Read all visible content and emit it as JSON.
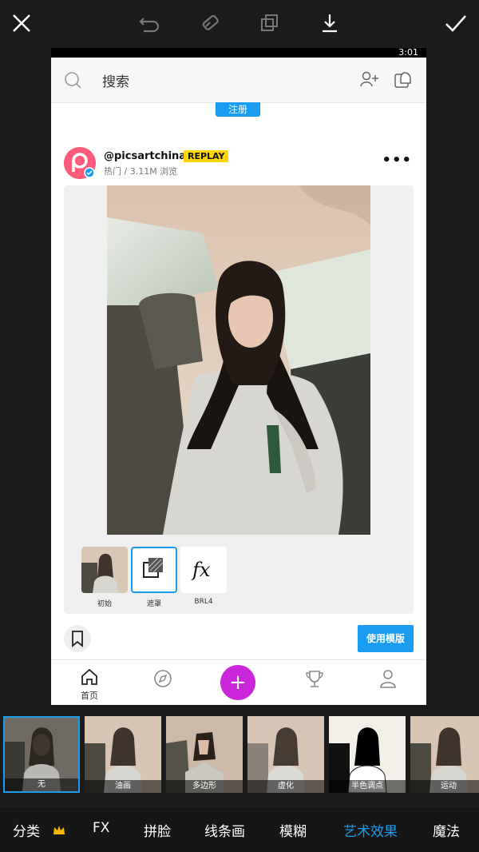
{
  "toolbar": {
    "close_icon": "close-icon",
    "undo_icon": "undo-icon",
    "eraser_icon": "eraser-icon",
    "compare_icon": "compare-icon",
    "download_icon": "download-icon",
    "apply_icon": "check-icon"
  },
  "status": {
    "time": "3:01"
  },
  "search": {
    "placeholder": "搜索"
  },
  "signup": {
    "label": "注册"
  },
  "post": {
    "username": "@picsartchina",
    "badge": "REPLAY",
    "meta": "热门 / 3.11M 浏览",
    "more": "•••"
  },
  "thumbs": [
    {
      "label": "初始"
    },
    {
      "label": "遮罩"
    },
    {
      "label": "BRL4"
    }
  ],
  "template_button": {
    "label": "使用模版"
  },
  "nav": {
    "home_label": "首页",
    "plus_label": "+"
  },
  "filters": [
    {
      "label": "无"
    },
    {
      "label": "油画"
    },
    {
      "label": "多边形"
    },
    {
      "label": "虚化"
    },
    {
      "label": "半色调点"
    },
    {
      "label": "运动"
    }
  ],
  "categories": [
    {
      "label": "分类"
    },
    {
      "label": "FX"
    },
    {
      "label": "拼脸"
    },
    {
      "label": "线条画"
    },
    {
      "label": "模糊"
    },
    {
      "label": "艺术效果"
    },
    {
      "label": "魔法"
    }
  ],
  "colors": {
    "accent": "#1a9cf0",
    "plus": "#c826d8",
    "badge": "#ffd600"
  }
}
